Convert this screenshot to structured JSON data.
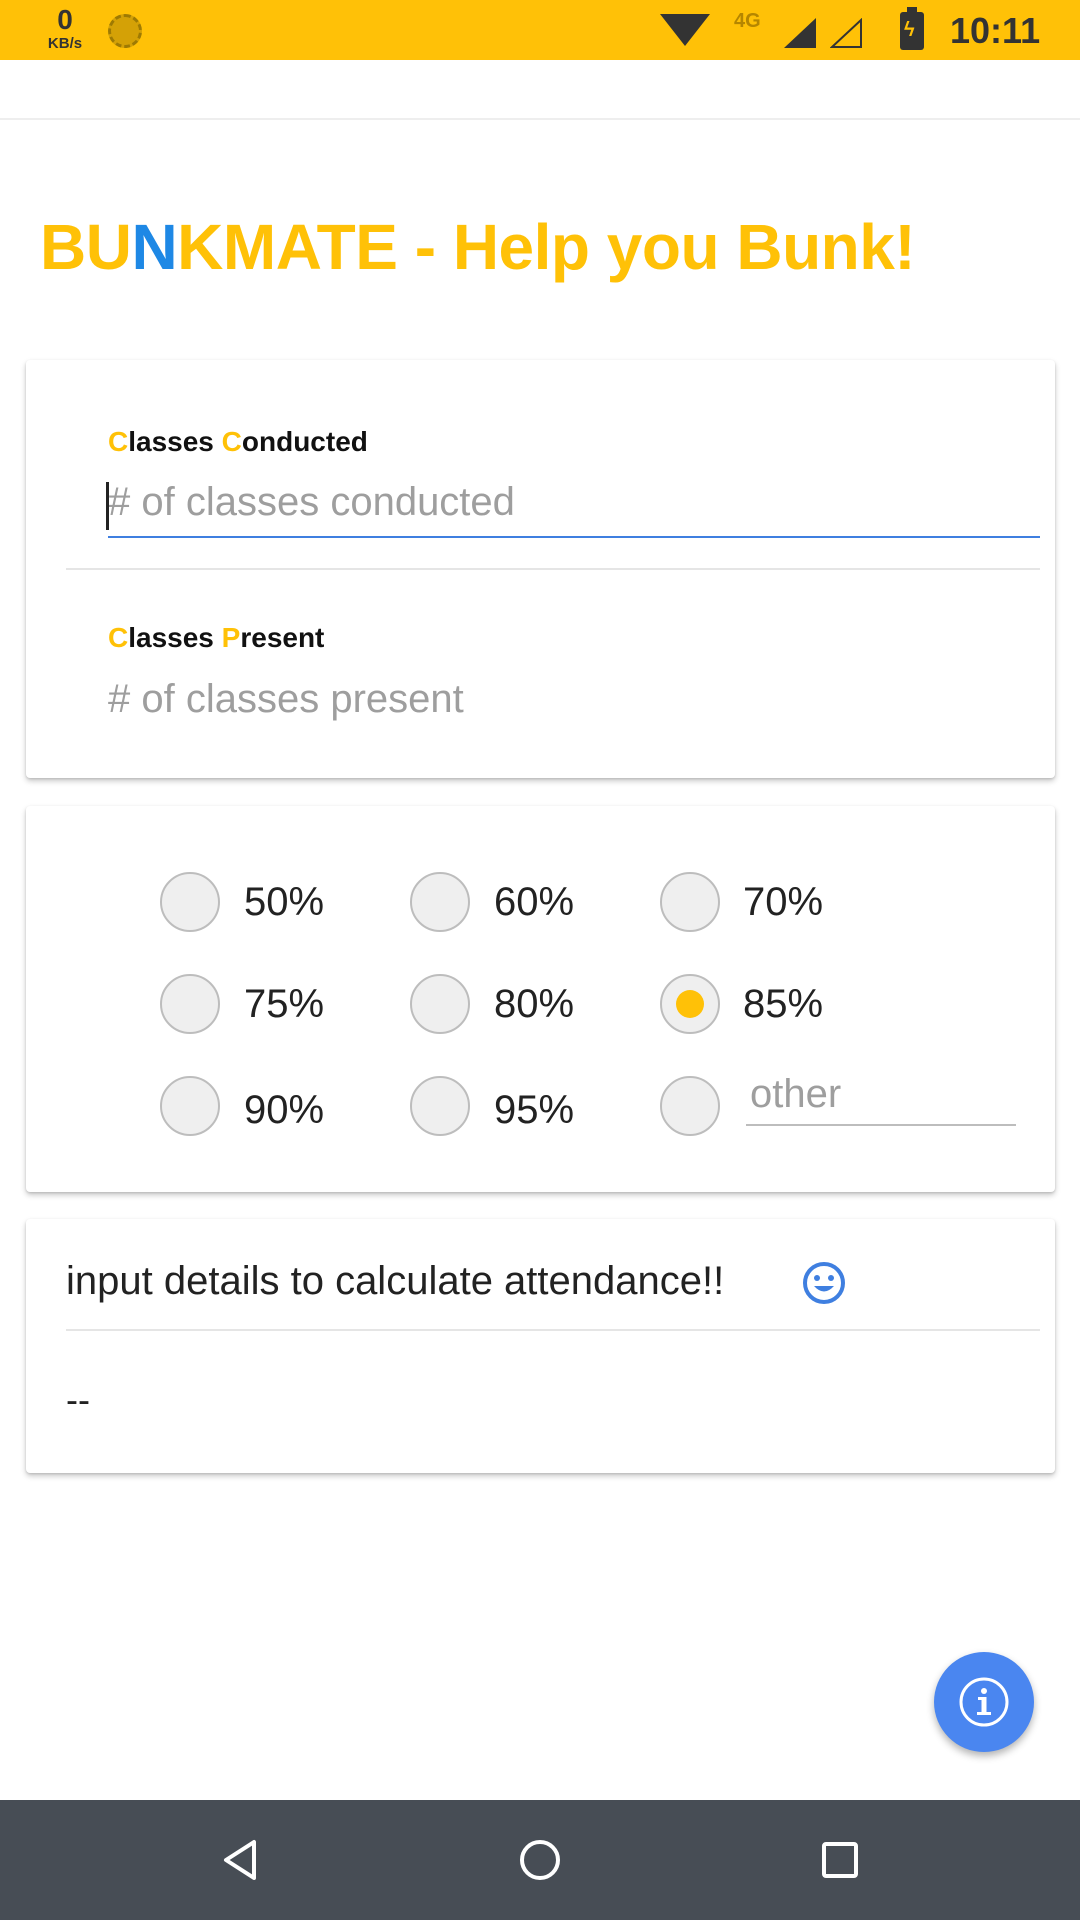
{
  "status_bar": {
    "net_speed_value": "0",
    "net_speed_unit": "KB/s",
    "network_type": "4G",
    "time": "10:11",
    "icons": [
      "sun-icon",
      "wifi-icon",
      "signal-icon",
      "signal-outline-icon",
      "battery-charging-icon"
    ]
  },
  "app": {
    "title_part1": "BU",
    "title_accent": "N",
    "title_part2": "KMATE - Help you Bunk!"
  },
  "inputs": {
    "conducted": {
      "label_first": "C",
      "label_rest1": "lasses ",
      "label_second": "C",
      "label_rest2": "onducted",
      "placeholder": "# of classes conducted",
      "value": ""
    },
    "present": {
      "label_first": "C",
      "label_rest1": "lasses ",
      "label_second": "P",
      "label_rest2": "resent",
      "placeholder": "# of classes present",
      "value": ""
    }
  },
  "percentages": {
    "options": [
      "50%",
      "60%",
      "70%",
      "75%",
      "80%",
      "85%",
      "90%",
      "95%"
    ],
    "selected": "85%",
    "other_placeholder": "other"
  },
  "result": {
    "heading": "input details to calculate attendance!!",
    "value": "--",
    "icon": "smile-icon"
  },
  "fab": {
    "icon": "info-icon"
  },
  "nav": {
    "icons": [
      "back-icon",
      "home-icon",
      "recents-icon"
    ]
  },
  "colors": {
    "accent": "#FFC107",
    "title_accent": "#1E88E5",
    "fab": "#4A86F0",
    "input_focus": "#3F7FE0",
    "nav_bar": "#474D55"
  }
}
